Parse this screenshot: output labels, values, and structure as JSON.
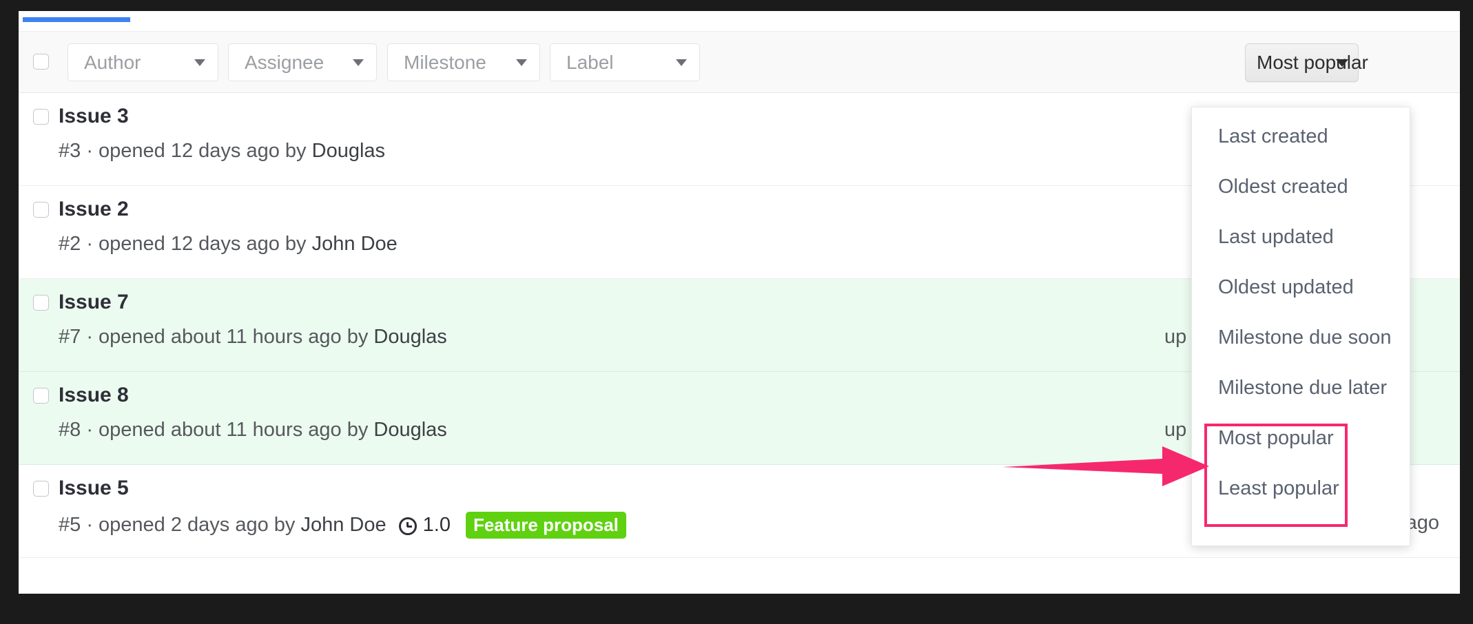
{
  "colors": {
    "accent_blue": "#3e82f2",
    "annotation_pink": "#f5286e",
    "label_green": "#5fd110",
    "row_highlight_green": "#ecfbf0",
    "toolbar_bg": "#f9f9fa",
    "frame_dark": "#1b1b1b"
  },
  "toolbar": {
    "select_all_checkbox": "",
    "filters": [
      {
        "name": "author",
        "placeholder": "Author",
        "value": ""
      },
      {
        "name": "assignee",
        "placeholder": "Assignee",
        "value": ""
      },
      {
        "name": "milestone",
        "placeholder": "Milestone",
        "value": ""
      },
      {
        "name": "label",
        "placeholder": "Label",
        "value": ""
      }
    ],
    "sort_button": {
      "label": "Most popular",
      "icon": "chevron-down-icon"
    }
  },
  "sort_menu": {
    "open": true,
    "items": [
      {
        "label": "Last created",
        "highlighted": false
      },
      {
        "label": "Oldest created",
        "highlighted": false
      },
      {
        "label": "Last updated",
        "highlighted": false
      },
      {
        "label": "Oldest updated",
        "highlighted": false
      },
      {
        "label": "Milestone due soon",
        "highlighted": false
      },
      {
        "label": "Milestone due later",
        "highlighted": false
      },
      {
        "label": "Most popular",
        "highlighted": true
      },
      {
        "label": "Least popular",
        "highlighted": true
      }
    ]
  },
  "issues": [
    {
      "title": "Issue 3",
      "meta": "#3 · opened 12 days ago by ",
      "author": "Douglas",
      "milestone": null,
      "label": null,
      "updated": "",
      "highlighted": false
    },
    {
      "title": "Issue 2",
      "meta": "#2 · opened 12 days ago by ",
      "author": "John Doe",
      "milestone": null,
      "label": null,
      "updated": "",
      "highlighted": false
    },
    {
      "title": "Issue 7",
      "meta": "#7 · opened about 11 hours ago by ",
      "author": "Douglas",
      "milestone": null,
      "label": null,
      "updated": "up",
      "updated_clipped": true,
      "highlighted": true
    },
    {
      "title": "Issue 8",
      "meta": "#8 · opened about 11 hours ago by ",
      "author": "Douglas",
      "milestone": null,
      "label": null,
      "updated": "up",
      "updated_clipped": true,
      "highlighted": true
    },
    {
      "title": "Issue 5",
      "meta": "#5 · opened 2 days ago by ",
      "author": "John Doe",
      "milestone": "1.0",
      "milestone_icon": "clock-icon",
      "label": "Feature proposal",
      "label_color": "#5fd110",
      "updated": "updated about a minute ago",
      "updated_clipped": false,
      "highlighted": false
    }
  ],
  "annotations": {
    "arrow": {
      "shape": "right-arrow",
      "color": "#f5286e"
    },
    "highlight_box": {
      "color": "#f5286e"
    }
  }
}
